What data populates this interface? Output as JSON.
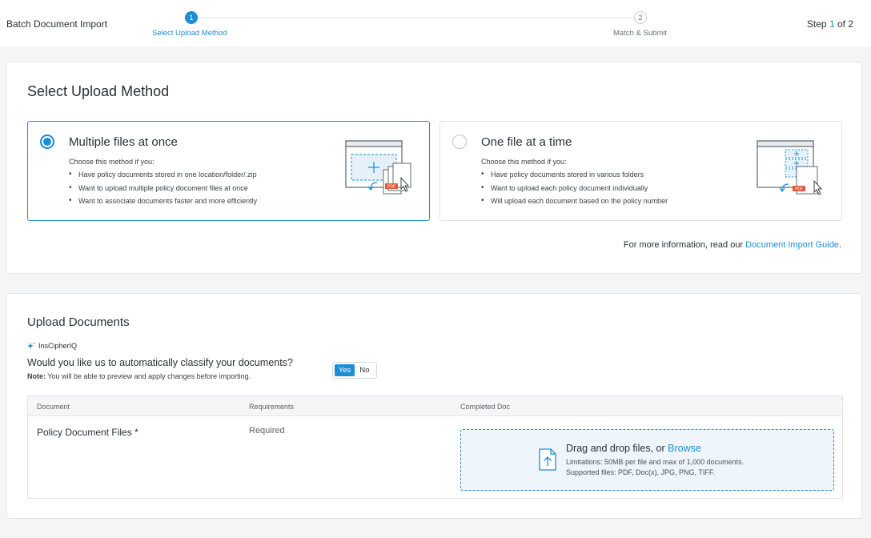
{
  "header": {
    "app_title": "Batch Document Import",
    "steps": [
      {
        "number": "1",
        "label": "Select Upload Method",
        "active": true
      },
      {
        "number": "2",
        "label": "Match & Submit",
        "active": false
      }
    ],
    "step_prefix": "Step ",
    "step_current": "1",
    "step_suffix": " of 2"
  },
  "method": {
    "title": "Select Upload Method",
    "options": [
      {
        "title": "Multiple files at once",
        "intro": "Choose this method if you:",
        "items": [
          "Have policy documents stored in one location/folder/.zip",
          "Want to upload multiple policy document files at once",
          "Want to associate documents faster and more efficiently"
        ],
        "selected": true,
        "illustration": "multiple-files-upload-illustration",
        "badge": "PDF"
      },
      {
        "title": "One file at a time",
        "intro": "Choose this method if you:",
        "items": [
          "Have policy documents stored in various folders",
          "Want to upload each policy document individually",
          "Will upload each document based on the policy number"
        ],
        "selected": false,
        "illustration": "single-file-upload-illustration",
        "badge": "PDF"
      }
    ],
    "info_prefix": "For more information, read our ",
    "info_link": "Document Import Guide",
    "info_suffix": "."
  },
  "upload": {
    "title": "Upload Documents",
    "ai_label": "InsCipherIQ",
    "question": "Would you like us to automatically classify your documents?",
    "note_label": "Note:",
    "note_text": " You will be able to preview and apply changes before importing.",
    "toggle": {
      "yes": "Yes",
      "no": "No",
      "selected": "Yes"
    },
    "table": {
      "headers": [
        "Document",
        "Requirements",
        "Completed Doc"
      ],
      "row": {
        "document": "Policy Document Files *",
        "requirement": "Required"
      }
    },
    "dropzone": {
      "title_prefix": "Drag and drop files, or ",
      "browse": "Browse",
      "limits": "Limitations: 50MB per file and max of 1,000 documents.",
      "types": "Supported files: PDF, Doc(x), JPG, PNG, TIFF."
    }
  },
  "colors": {
    "accent": "#1b8ed6",
    "pdf_badge": "#e8553e",
    "background": "#f4f5f7"
  }
}
